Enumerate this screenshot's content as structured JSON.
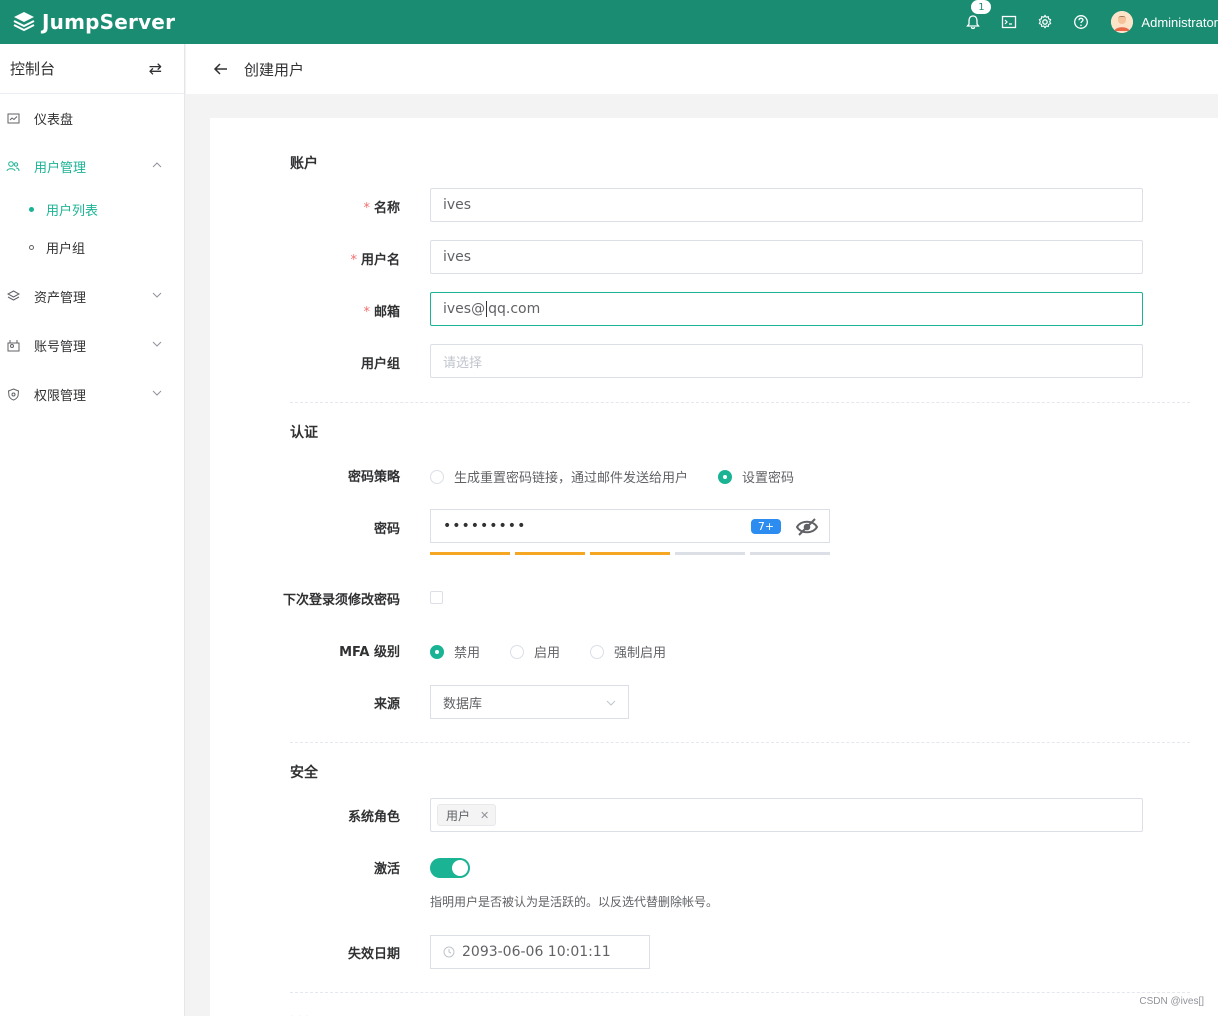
{
  "topbar": {
    "brand": "JumpServer",
    "notification_count": "1",
    "user_name": "Administrator",
    "icons": [
      "bell-icon",
      "terminal-icon",
      "gear-icon",
      "help-icon"
    ],
    "bg_color": "#1a8c72"
  },
  "sidebar": {
    "title": "控制台",
    "items": [
      {
        "label": "仪表盘",
        "icon": "dashboard-icon"
      },
      {
        "label": "用户管理",
        "icon": "users-icon",
        "expanded": true,
        "active": true
      },
      {
        "label": "资产管理",
        "icon": "assets-icon"
      },
      {
        "label": "账号管理",
        "icon": "accounts-icon"
      },
      {
        "label": "权限管理",
        "icon": "shield-icon"
      }
    ],
    "subitems": [
      {
        "label": "用户列表",
        "active": true
      },
      {
        "label": "用户组",
        "active": false
      }
    ]
  },
  "page": {
    "title": "创建用户"
  },
  "form": {
    "sections": {
      "account": "账户",
      "auth": "认证",
      "security": "安全"
    },
    "name": {
      "label": "名称",
      "value": "ives"
    },
    "username": {
      "label": "用户名",
      "value": "ives"
    },
    "email": {
      "label": "邮箱",
      "value_before_caret": "ives@",
      "value_after_caret": "qq.com"
    },
    "groups": {
      "label": "用户组",
      "placeholder": "请选择"
    },
    "password_strategy": {
      "label": "密码策略",
      "options": [
        "生成重置密码链接，通过邮件发送给用户",
        "设置密码"
      ],
      "selected": "设置密码"
    },
    "password": {
      "label": "密码",
      "masked_value": "•••••••••",
      "length_badge": "7+",
      "strength_level": 3,
      "strength_total": 5
    },
    "must_change": {
      "label": "下次登录须修改密码",
      "checked": false
    },
    "mfa": {
      "label": "MFA 级别",
      "options": [
        "禁用",
        "启用",
        "强制启用"
      ],
      "selected": "禁用"
    },
    "source": {
      "label": "来源",
      "value": "数据库"
    },
    "roles": {
      "label": "系统角色",
      "tags": [
        "用户"
      ]
    },
    "active": {
      "label": "激活",
      "on": true,
      "hint": "指明用户是否被认为是活跃的。以反选代替删除帐号。"
    },
    "expire": {
      "label": "失效日期",
      "value": "2093-06-06 10:01:11"
    },
    "next_section_partial": "· · ·"
  },
  "watermark": "CSDN @ives[]",
  "colors": {
    "accent": "#1ab394",
    "strength_on": "#f5a623",
    "strength_off": "#dcdfe6",
    "badge_blue": "#2d8cf0",
    "required": "#f56c6c"
  }
}
